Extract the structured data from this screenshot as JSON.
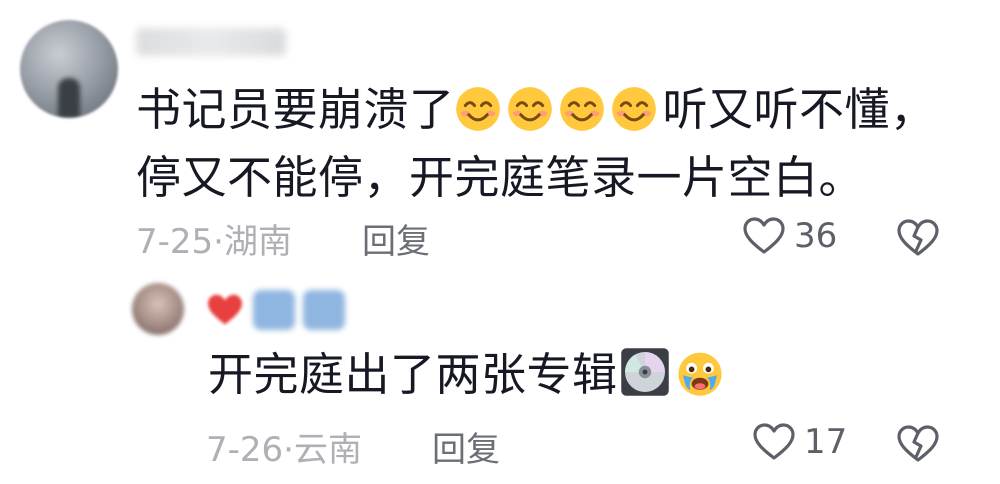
{
  "comments": [
    {
      "text_line1_part1": "书记员要崩溃了",
      "text_line1_part2": "听又听不懂，",
      "text_line2": "停又不能停，开完庭笔录一片空白。",
      "date_location": "7-25·湖南",
      "reply_label": "回复",
      "like_count": "36",
      "emoji_count": 4
    },
    {
      "text": "开完庭出了两张专辑",
      "date_location": "7-26·云南",
      "reply_label": "回复",
      "like_count": "17"
    }
  ],
  "icons": {
    "like": "heart-outline-icon",
    "dislike": "broken-heart-icon",
    "smile": "smiling-face-emoji",
    "disc": "cd-disc-emoji",
    "cry": "crying-face-emoji"
  },
  "colors": {
    "text": "#161823",
    "meta": "#aeb0b5",
    "reply": "#6b6e75",
    "emoji_yellow": "#ffc83d"
  }
}
